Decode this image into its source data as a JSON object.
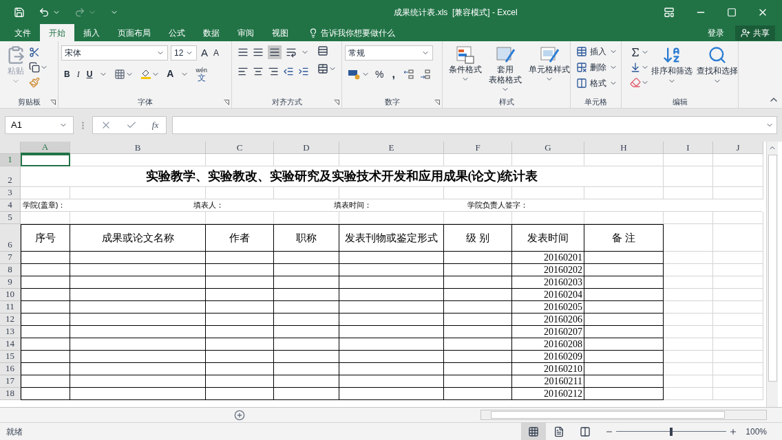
{
  "window": {
    "title": "成果统计表.xls  [兼容模式] - Excel"
  },
  "ribbon_tabs": [
    {
      "label": "文件",
      "selected": false
    },
    {
      "label": "开始",
      "selected": true
    },
    {
      "label": "插入",
      "selected": false
    },
    {
      "label": "页面布局",
      "selected": false
    },
    {
      "label": "公式",
      "selected": false
    },
    {
      "label": "数据",
      "selected": false
    },
    {
      "label": "审阅",
      "selected": false
    },
    {
      "label": "视图",
      "selected": false
    }
  ],
  "tell_me": "告诉我你想要做什么",
  "account": {
    "sign_in": "登录",
    "share": "共享"
  },
  "ribbon": {
    "clipboard": {
      "label": "剪贴板",
      "paste": "粘贴"
    },
    "font": {
      "label": "字体",
      "name": "宋体",
      "size": "12",
      "bold": "B",
      "italic": "I",
      "underline": "U",
      "color_letter": "A",
      "grow": "A",
      "shrink": "A",
      "phonetic_top": "wén",
      "phonetic_bottom": "文"
    },
    "alignment": {
      "label": "对齐方式"
    },
    "number": {
      "label": "数字",
      "format": "常规",
      "percent": "%",
      "comma": ","
    },
    "styles": {
      "label": "样式",
      "buttons": [
        {
          "lines": [
            "条件格式"
          ]
        },
        {
          "lines": [
            "套用",
            "表格格式"
          ]
        },
        {
          "lines": [
            "单元格样式"
          ]
        }
      ]
    },
    "cells": {
      "label": "单元格",
      "buttons": [
        "插入",
        "删除",
        "格式"
      ]
    },
    "editing": {
      "label": "编辑",
      "buttons": [
        "排序和筛选",
        "查找和选择"
      ]
    }
  },
  "formula_bar": {
    "name_box": "A1",
    "fx": "fx"
  },
  "sheet": {
    "columns": [
      {
        "label": "A",
        "selected": true
      },
      {
        "label": "B",
        "selected": false
      },
      {
        "label": "C",
        "selected": false
      },
      {
        "label": "D",
        "selected": false
      },
      {
        "label": "E",
        "selected": false
      },
      {
        "label": "F",
        "selected": false
      },
      {
        "label": "G",
        "selected": false
      },
      {
        "label": "H",
        "selected": false
      },
      {
        "label": "I",
        "selected": false
      },
      {
        "label": "J",
        "selected": false
      }
    ],
    "row_headers": [
      {
        "label": "1",
        "selected": true
      },
      {
        "label": "2",
        "selected": false
      },
      {
        "label": "3",
        "selected": false
      },
      {
        "label": "4",
        "selected": false
      },
      {
        "label": "5",
        "selected": false
      },
      {
        "label": "6",
        "selected": false
      },
      {
        "label": "7",
        "selected": false
      },
      {
        "label": "8",
        "selected": false
      },
      {
        "label": "9",
        "selected": false
      },
      {
        "label": "10",
        "selected": false
      },
      {
        "label": "11",
        "selected": false
      },
      {
        "label": "12",
        "selected": false
      },
      {
        "label": "13",
        "selected": false
      },
      {
        "label": "14",
        "selected": false
      },
      {
        "label": "15",
        "selected": false
      },
      {
        "label": "16",
        "selected": false
      },
      {
        "label": "17",
        "selected": false
      },
      {
        "label": "18",
        "selected": false
      }
    ],
    "title": "实验教学、实验教改、实验研究及实验技术开发和应用成果(论文)统计表",
    "info": [
      "学院(盖章)：",
      "填表人：",
      "填表时间：",
      "学院负责人签字："
    ],
    "headers": [
      "序号",
      "成果或论文名称",
      "作者",
      "职称",
      "发表刊物或鉴定形式",
      "级 别",
      "发表时间",
      "备 注"
    ],
    "publish_times": [
      "20160201",
      "20160202",
      "20160203",
      "20160204",
      "20160205",
      "20160206",
      "20160207",
      "20160208",
      "20160209",
      "20160210",
      "20160211",
      "20160212"
    ]
  },
  "status_bar": {
    "status": "就绪",
    "zoom": "100%",
    "zoom_slider": {
      "level": 0.5
    }
  }
}
